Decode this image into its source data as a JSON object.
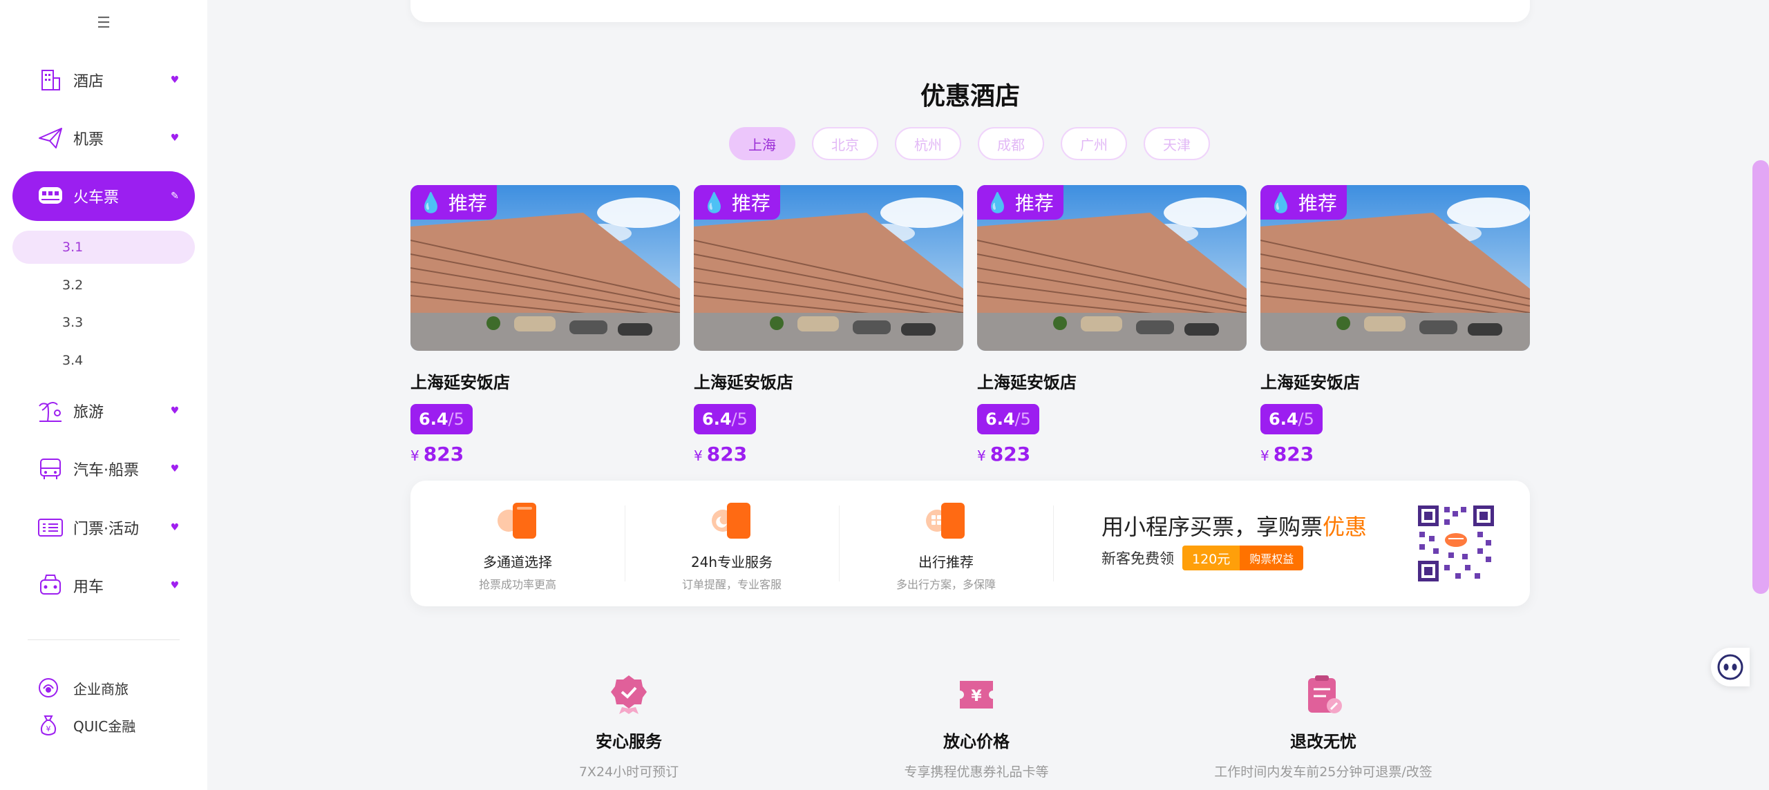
{
  "sidebar": {
    "menu_icon": "menu-lines-icon",
    "items": [
      {
        "label": "酒店",
        "icon": "hotel-icon"
      },
      {
        "label": "机票",
        "icon": "paper-plane-icon"
      },
      {
        "label": "火车票",
        "icon": "train-icon"
      },
      {
        "label": "旅游",
        "icon": "island-icon"
      },
      {
        "label": "汽车·船票",
        "icon": "bus-icon"
      },
      {
        "label": "门票·活动",
        "icon": "ticket-icon"
      },
      {
        "label": "用车",
        "icon": "car-icon"
      }
    ],
    "sub_items": [
      "3.1",
      "3.2",
      "3.3",
      "3.4"
    ],
    "bottom_links": [
      {
        "label": "企业商旅",
        "icon": "business-icon"
      },
      {
        "label": "QUIC金融",
        "icon": "money-bag-icon"
      }
    ]
  },
  "section": {
    "title": "优惠酒店",
    "cities": [
      "上海",
      "北京",
      "杭州",
      "成都",
      "广州",
      "天津"
    ],
    "active_city": "上海"
  },
  "hotels": [
    {
      "badge": "推荐",
      "name": "上海延安饭店",
      "score": "6.4",
      "score_den": "/5",
      "currency": "¥",
      "price": "823"
    },
    {
      "badge": "推荐",
      "name": "上海延安饭店",
      "score": "6.4",
      "score_den": "/5",
      "currency": "¥",
      "price": "823"
    },
    {
      "badge": "推荐",
      "name": "上海延安饭店",
      "score": "6.4",
      "score_den": "/5",
      "currency": "¥",
      "price": "823"
    },
    {
      "badge": "推荐",
      "name": "上海延安饭店",
      "score": "6.4",
      "score_den": "/5",
      "currency": "¥",
      "price": "823"
    }
  ],
  "features": [
    {
      "title": "多通道选择",
      "desc": "抢票成功率更高"
    },
    {
      "title": "24h专业服务",
      "desc": "订单提醒，专业客服"
    },
    {
      "title": "出行推荐",
      "desc": "多出行方案，多保障"
    }
  ],
  "promo": {
    "title_main": "用小程序买票，享购票",
    "title_highlight": "优惠",
    "subtitle": "新客免费领",
    "amount": "120元",
    "action": "购票权益"
  },
  "services": [
    {
      "title": "安心服务",
      "desc": "7X24小时可预订",
      "icon": "badge-check-icon"
    },
    {
      "title": "放心价格",
      "desc": "专享携程优惠券礼品卡等",
      "icon": "yen-ticket-icon"
    },
    {
      "title": "退改无忧",
      "desc": "工作时间内发车前25分钟可退票/改签",
      "icon": "clipboard-edit-icon"
    }
  ],
  "colors": {
    "accent": "#9c1ef0",
    "orange": "#ff7a00",
    "pink": "#e0609a"
  }
}
